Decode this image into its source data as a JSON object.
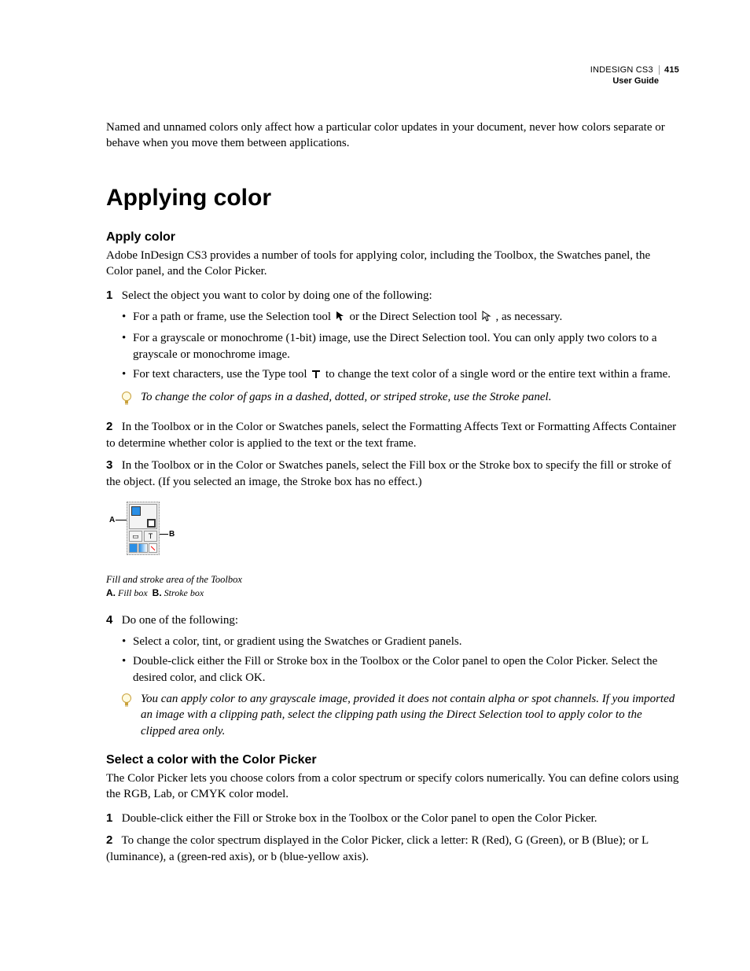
{
  "header": {
    "product": "INDESIGN CS3",
    "doc": "User Guide",
    "page": "415"
  },
  "intro": "Named and unnamed colors only affect how a particular color updates in your document, never how colors separate or behave when you move them between applications.",
  "h1": "Applying color",
  "s1": {
    "title": "Apply color",
    "lead": "Adobe InDesign CS3 provides a number of tools for applying color, including the Toolbox, the Swatches panel, the Color panel, and the Color Picker.",
    "step1": "Select the object you want to color by doing one of the following:",
    "b1a_pre": "For a path or frame, use the Selection tool ",
    "b1a_mid": " or the Direct Selection tool ",
    "b1a_post": " , as necessary.",
    "b1b": "For a grayscale or monochrome (1-bit) image, use the Direct Selection tool. You can only apply two colors to a grayscale or monochrome image.",
    "b1c_pre": "For text characters, use the Type tool ",
    "b1c_post": " to change the text color of a single word or the entire text within a frame.",
    "tip1": "To change the color of gaps in a dashed, dotted, or striped stroke, use the Stroke panel.",
    "step2": "In the Toolbox or in the Color or Swatches panels, select the Formatting Affects Text or Formatting Affects Container to determine whether color is applied to the text or the text frame.",
    "step3": "In the Toolbox or in the Color or Swatches panels, select the Fill box or the Stroke box to specify the fill or stroke of the object. (If you selected an image, the Stroke box has no effect.)",
    "fig_caption": "Fill and stroke area of the Toolbox",
    "fig_a_key": "A.",
    "fig_a_val": "Fill box",
    "fig_b_key": "B.",
    "fig_b_val": "Stroke box",
    "lbl_a": "A",
    "lbl_b": "B",
    "lbl_t": "T",
    "step4": "Do one of the following:",
    "b4a": "Select a color, tint, or gradient using the Swatches or Gradient panels.",
    "b4b": "Double-click either the Fill or Stroke box in the Toolbox or the Color panel to open the Color Picker. Select the desired color, and click OK.",
    "tip2": "You can apply color to any grayscale image, provided it does not contain alpha or spot channels. If you imported an image with a clipping path, select the clipping path using the Direct Selection tool to apply color to the clipped area only."
  },
  "s2": {
    "title": "Select a color with the Color Picker",
    "lead": "The Color Picker lets you choose colors from a color spectrum or specify colors numerically. You can define colors using the RGB, Lab, or CMYK color model.",
    "step1": "Double-click either the Fill or Stroke box in the Toolbox or the Color panel to open the Color Picker.",
    "step2": "To change the color spectrum displayed in the Color Picker, click a letter: R (Red), G (Green), or B (Blue); or L (luminance), a (green-red axis), or b (blue-yellow axis)."
  },
  "nums": {
    "n1": "1",
    "n2": "2",
    "n3": "3",
    "n4": "4"
  }
}
